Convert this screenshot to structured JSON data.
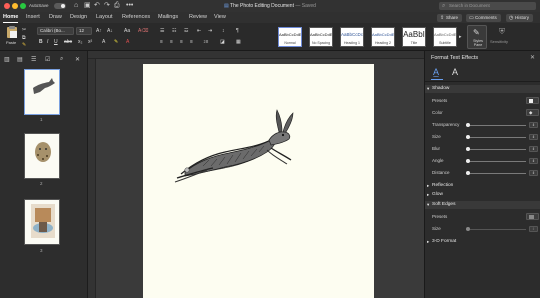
{
  "app": {
    "autosave_label": "AutoSave",
    "toggle_state": "OFF",
    "document_title": "The Photo Editing Document",
    "saved_status": "— Saved",
    "search_placeholder": "Search in Document"
  },
  "menu": {
    "tabs": [
      "Home",
      "Insert",
      "Draw",
      "Design",
      "Layout",
      "References",
      "Mailings",
      "Review",
      "View"
    ],
    "active_tab": "Home",
    "share_label": "Share",
    "comments_label": "Comments",
    "history_label": "History"
  },
  "ribbon": {
    "paste_label": "Paste",
    "font_name": "Calibri (Bo...",
    "font_size": "12",
    "styles": [
      {
        "sample": "AaBbCcDdEe",
        "name": "Normal"
      },
      {
        "sample": "AaBbCcDdEe",
        "name": "No Spacing"
      },
      {
        "sample": "AaBbCcDc",
        "name": "Heading 1"
      },
      {
        "sample": "AaBbCcDdE",
        "name": "Heading 2"
      },
      {
        "sample": "AaBbI",
        "name": "Title"
      },
      {
        "sample": "AaBbCcDdEe",
        "name": "Subtitle"
      }
    ],
    "styles_pane_label": "Styles Pane",
    "sensitivity_label": "Sensitivity"
  },
  "nav": {
    "page_numbers": [
      "1",
      "2",
      "3"
    ]
  },
  "format_pane": {
    "title": "Format Text Effects",
    "sections": {
      "shadow": "Shadow",
      "reflection": "Reflection",
      "glow": "Glow",
      "soft_edges": "Soft Edges",
      "three_d": "3-D Format"
    },
    "shadow": {
      "presets_label": "Presets",
      "color_label": "Color",
      "transparency_label": "Transparency",
      "size_label": "Size",
      "blur_label": "Blur",
      "angle_label": "Angle",
      "distance_label": "Distance"
    },
    "soft_edges": {
      "presets_label": "Presets",
      "size_label": "Size"
    }
  },
  "icons": [
    "apple-icon",
    "home-icon",
    "save-icon",
    "undo-icon",
    "redo-icon",
    "print-icon",
    "search-icon",
    "share-icon",
    "comments-icon",
    "history-icon",
    "paste-icon",
    "close-icon",
    "text-fill-icon",
    "text-effects-icon"
  ]
}
